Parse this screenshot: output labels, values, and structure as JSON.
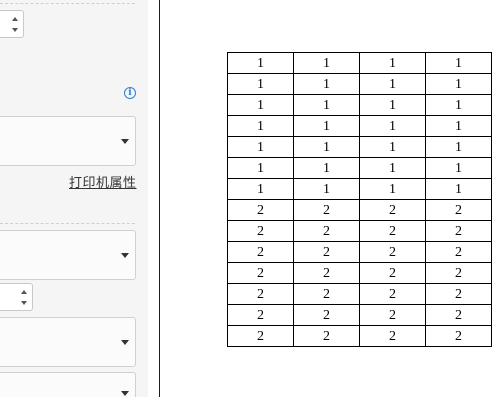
{
  "settings": {
    "printer_properties_link": "打印机属性",
    "info_icon_glyph": "i"
  },
  "table": {
    "rows": [
      [
        "1",
        "1",
        "1",
        "1"
      ],
      [
        "1",
        "1",
        "1",
        "1"
      ],
      [
        "1",
        "1",
        "1",
        "1"
      ],
      [
        "1",
        "1",
        "1",
        "1"
      ],
      [
        "1",
        "1",
        "1",
        "1"
      ],
      [
        "1",
        "1",
        "1",
        "1"
      ],
      [
        "1",
        "1",
        "1",
        "1"
      ],
      [
        "2",
        "2",
        "2",
        "2"
      ],
      [
        "2",
        "2",
        "2",
        "2"
      ],
      [
        "2",
        "2",
        "2",
        "2"
      ],
      [
        "2",
        "2",
        "2",
        "2"
      ],
      [
        "2",
        "2",
        "2",
        "2"
      ],
      [
        "2",
        "2",
        "2",
        "2"
      ],
      [
        "2",
        "2",
        "2",
        "2"
      ]
    ]
  },
  "colors": {
    "pane_background": "#f5f5f5",
    "link_text": "#333333",
    "info_icon": "#2f7fd6",
    "table_border": "#000000"
  }
}
